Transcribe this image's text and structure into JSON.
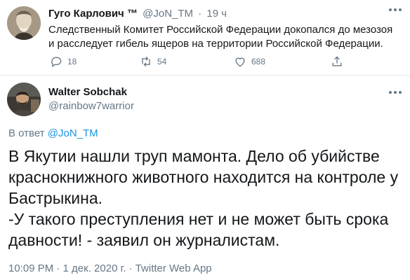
{
  "tweet_quoted": {
    "author_name": "Гуго Карлович",
    "author_badge": "™",
    "handle": "@JoN_TM",
    "separator": "·",
    "time": "19 ч",
    "text": "Следственный Комитет Российской Федерации докопался до мезозоя и расследует гибель ящеров на территории Российской Федерации.",
    "actions": {
      "replies": "18",
      "retweets": "54",
      "likes": "688"
    }
  },
  "tweet_main": {
    "author_name": "Walter Sobchak",
    "handle": "@rainbow7warrior",
    "reply_prefix": "В ответ",
    "reply_to": "@JoN_TM",
    "text": "В Якутии нашли труп мамонта. Дело об убийстве краснокнижного животного находится на контроле у Бастрыкина.\n-У такого преступления нет и не может быть срока давности! - заявил он журналистам.",
    "timestamp": "10:09 PM · 1 дек. 2020 г. · Twitter Web App"
  },
  "colors": {
    "accent": "#1b95e0",
    "muted": "#657786",
    "text": "#14171a"
  }
}
